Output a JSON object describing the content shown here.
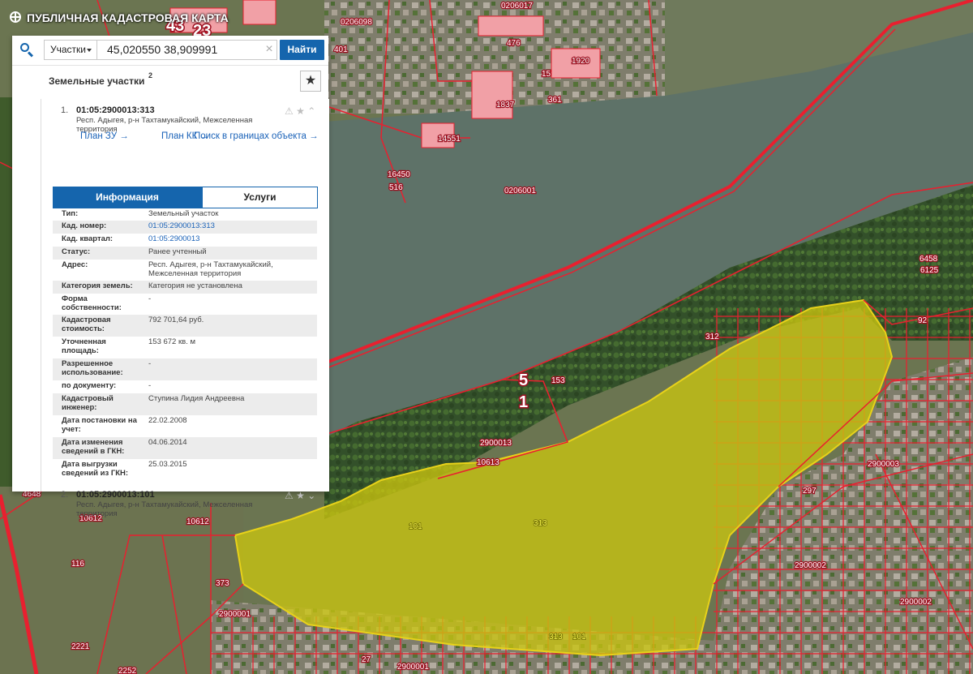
{
  "app": {
    "title": "ПУБЛИЧНАЯ КАДАСТРОВАЯ КАРТА"
  },
  "search": {
    "type_selected": "Участки",
    "query": "45,020550 38,909991",
    "find_label": "Найти"
  },
  "results": {
    "title": "Земельные участки",
    "count": "2",
    "items": [
      {
        "num": "1.",
        "cadastral_number": "01:05:2900013:313",
        "address": "Респ. Адыгея, р-н Тахтамукайский, Межселенная территория"
      },
      {
        "num": "2.",
        "cadastral_number": "01:05:2900013:101",
        "address": "Респ. Адыгея, р-н Тахтамукайский, Межселенная территория"
      }
    ],
    "links": {
      "plan_zu": "План ЗУ →",
      "plan_kk": "План КК →",
      "search_bounds": "Поиск в границах объекта →"
    },
    "tabs": {
      "info": "Информация",
      "services": "Услуги"
    }
  },
  "info": [
    {
      "key": "Тип:",
      "value": "Земельный участок"
    },
    {
      "key": "Кад. номер:",
      "value": "01:05:2900013:313",
      "link": true
    },
    {
      "key": "Кад. квартал:",
      "value": "01:05:2900013",
      "link": true
    },
    {
      "key": "Статус:",
      "value": "Ранее учтенный"
    },
    {
      "key": "Адрес:",
      "value": "Респ. Адыгея, р-н Тахтамукайский, Межселенная территория"
    },
    {
      "key": "Категория земель:",
      "value": "Категория не установлена"
    },
    {
      "key": "Форма собственности:",
      "value": "-"
    },
    {
      "key": "Кадастровая стоимость:",
      "value": "792 701,64 руб."
    },
    {
      "key": "Уточненная площадь:",
      "value": "153 672 кв. м"
    },
    {
      "key": "Разрешенное использование:",
      "value": "-"
    },
    {
      "key": "по документу:",
      "value": "-"
    },
    {
      "key": "Кадастровый инженер:",
      "value": "Ступина Лидия Андреевна"
    },
    {
      "key": "Дата постановки на учет:",
      "value": "22.02.2008"
    },
    {
      "key": "Дата изменения сведений в ГКН:",
      "value": "04.06.2014"
    },
    {
      "key": "Дата выгрузки сведений из ГКН:",
      "value": "25.03.2015"
    }
  ],
  "map": {
    "colors": {
      "parcel_border": "#e8202f",
      "selected_parcel_fill": "#c9c410",
      "river": "#5e7268",
      "vegetation": "#3c5a28",
      "urban": "#8a8878"
    },
    "labels": {
      "q0206001": "0206001",
      "q0206098": "0206098",
      "q0206017": "0206017",
      "q020600": "020600",
      "q2900013": "2900013",
      "q2900001_a": "2900001",
      "q2900001_b": "2900001",
      "q2900002_a": "2900002",
      "q2900002_b": "2900002",
      "q2900003": "2900003",
      "p43": "43",
      "p23": "23",
      "p5": "5",
      "p1": "1",
      "p312": "312",
      "p313": "313",
      "p313b": "313",
      "p101": "101",
      "p101b": "101",
      "p153": "153",
      "p10613": "10613",
      "p10612": "10612",
      "p10612b": "10612",
      "p4648": "4648",
      "p116": "116",
      "p2221": "2221",
      "p2252": "2252",
      "p14551": "14551",
      "p16450": "16450",
      "p516": "516",
      "p476": "476",
      "p1837": "1837",
      "p1920": "1920",
      "p361": "361",
      "p15": "15",
      "p401": "401",
      "p6458": "6458",
      "p6125": "6125",
      "p92": "92",
      "p297": "297",
      "p27": "27",
      "p373": "373"
    }
  }
}
